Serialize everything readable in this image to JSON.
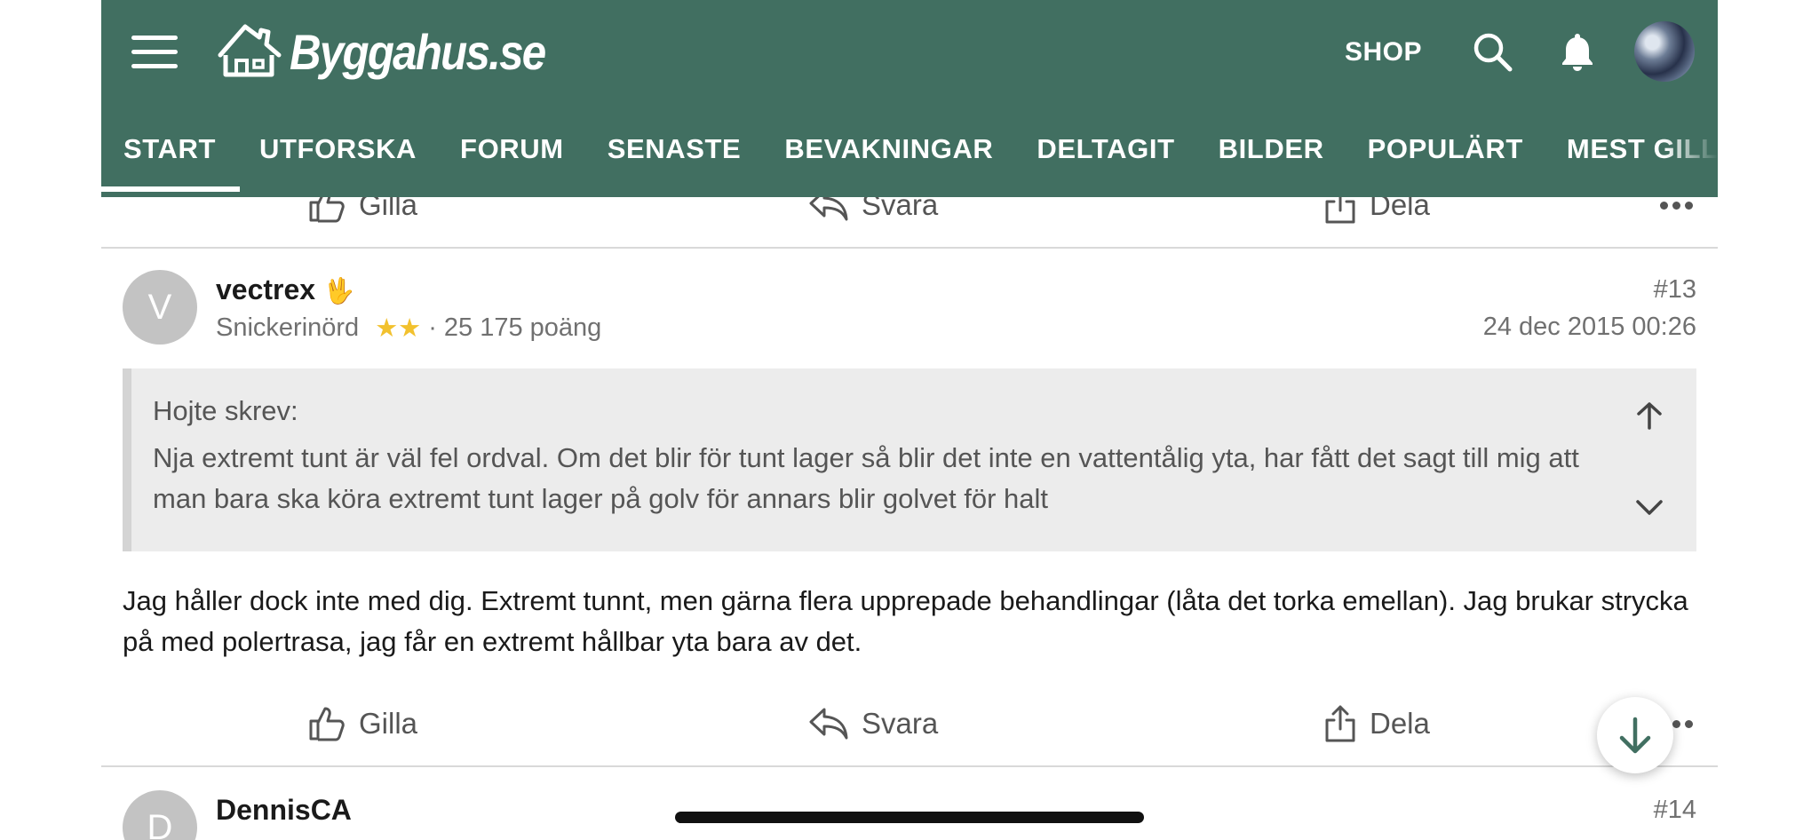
{
  "header": {
    "logo_text": "Byggahus.se",
    "shop_label": "SHOP",
    "nav": [
      "START",
      "UTFORSKA",
      "FORUM",
      "SENASTE",
      "BEVAKNINGAR",
      "DELTAGIT",
      "BILDER",
      "POPULÄRT",
      "MEST GILLADE"
    ],
    "active_nav": "START",
    "brand_color": "#416f61"
  },
  "actions": {
    "like": "Gilla",
    "reply": "Svara",
    "share": "Dela"
  },
  "posts": [
    {
      "avatar_letter": "V",
      "user": "vectrex",
      "user_emoji": "🖖",
      "role": "Snickerinörd",
      "stars": "★★",
      "points": "· 25 175 poäng",
      "number": "#13",
      "date": "24 dec 2015 00:26",
      "quote": {
        "author": "Hojte skrev:",
        "text": "Nja extremt tunt är väl fel ordval. Om det blir för tunt lager så blir det inte en vattentålig yta, har fått det sagt till mig att man bara ska köra extremt tunt lager på golv för annars blir golvet för halt"
      },
      "body": "Jag håller dock inte med dig. Extremt tunnt, men gärna flera upprepade behandlingar (låta det torka emellan). Jag brukar strycka på med polertrasa, jag får en extremt hållbar yta bara av det."
    },
    {
      "avatar_letter": "D",
      "user": "DennisCA",
      "number": "#14"
    }
  ]
}
